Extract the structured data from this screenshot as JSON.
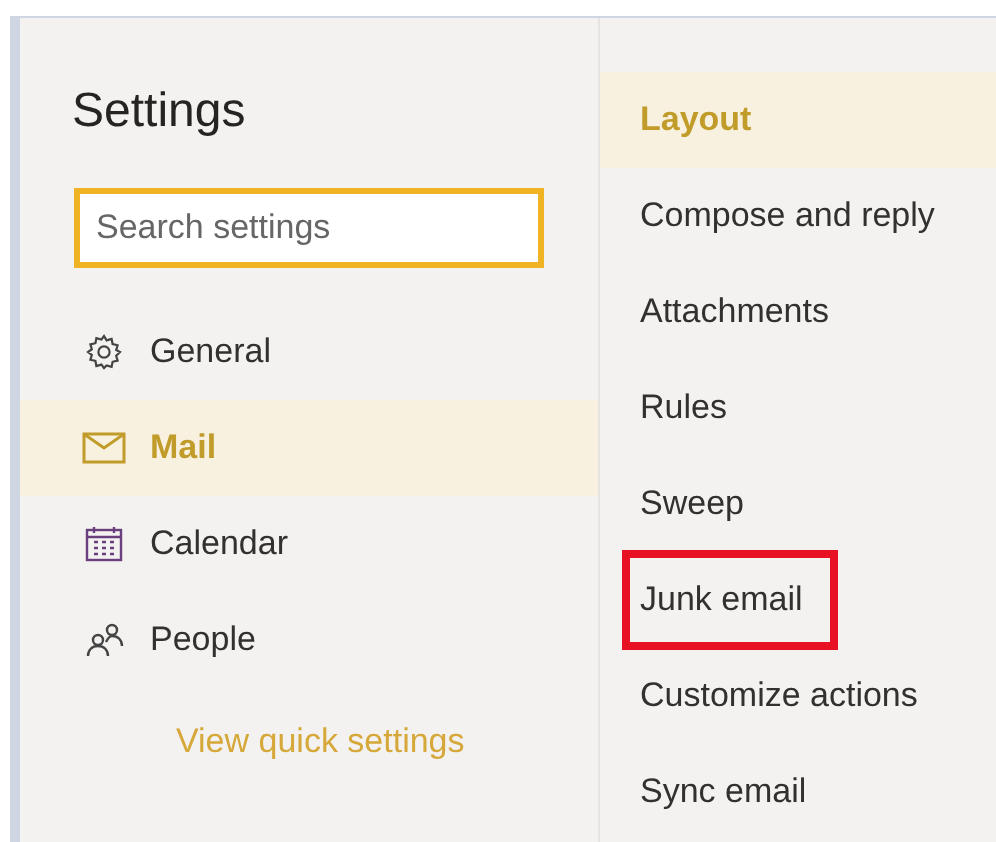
{
  "title": "Settings",
  "search": {
    "placeholder": "Search settings",
    "focused": true
  },
  "nav": [
    {
      "label": "General",
      "kind": "gear",
      "selected": false
    },
    {
      "label": "Mail",
      "kind": "mail",
      "selected": true
    },
    {
      "label": "Calendar",
      "kind": "calendar",
      "selected": false
    },
    {
      "label": "People",
      "kind": "people",
      "selected": false
    }
  ],
  "quick_link": "View quick settings",
  "subnav": [
    {
      "label": "Layout",
      "selected": true,
      "annotated": false
    },
    {
      "label": "Compose and reply",
      "selected": false,
      "annotated": false
    },
    {
      "label": "Attachments",
      "selected": false,
      "annotated": false
    },
    {
      "label": "Rules",
      "selected": false,
      "annotated": false
    },
    {
      "label": "Sweep",
      "selected": false,
      "annotated": false
    },
    {
      "label": "Junk email",
      "selected": false,
      "annotated": true
    },
    {
      "label": "Customize actions",
      "selected": false,
      "annotated": false
    },
    {
      "label": "Sync email",
      "selected": false,
      "annotated": false
    }
  ]
}
